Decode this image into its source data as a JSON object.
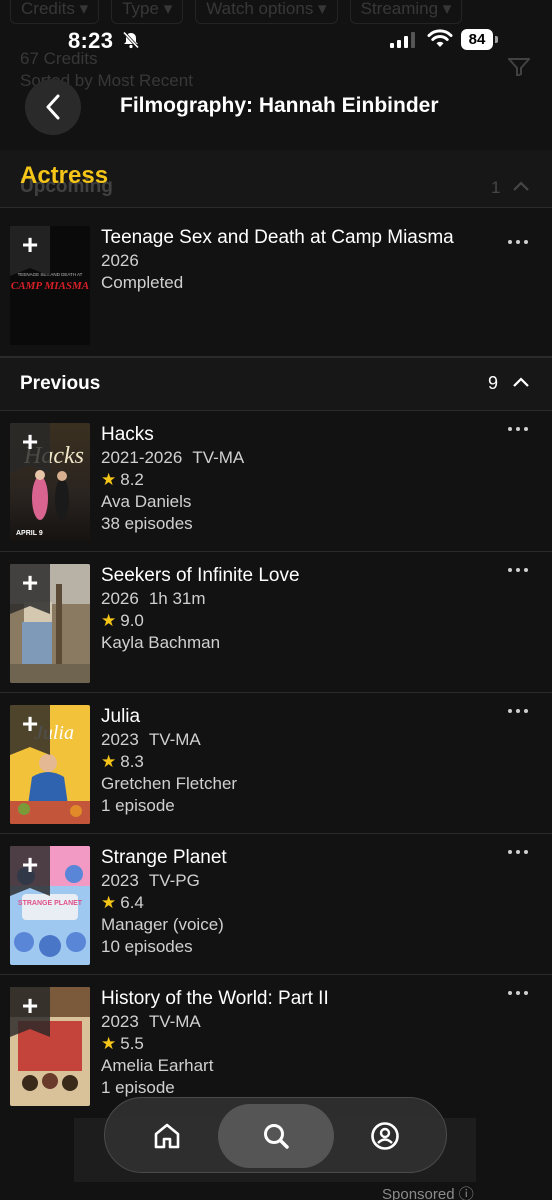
{
  "background_ghost": {
    "filter_chips": [
      "Credits ▾",
      "Type ▾",
      "Watch options ▾",
      "Streaming ▾"
    ],
    "credits_count": "67 Credits",
    "sorted_by": "Sorted by Most Recent"
  },
  "status_bar": {
    "time": "8:23",
    "battery": "84"
  },
  "header": {
    "title": "Filmography: Hannah Einbinder"
  },
  "actress_section": {
    "label": "Actress",
    "upcoming_ghost": "Upcoming",
    "upcoming_count": "1"
  },
  "upcoming": [
    {
      "title": "Teenage Sex and Death at Camp Miasma",
      "year": "2026",
      "status": "Completed"
    }
  ],
  "previous_section": {
    "label": "Previous",
    "count": "9"
  },
  "previous": [
    {
      "title": "Hacks",
      "year": "2021-2026",
      "cert": "TV-MA",
      "rating": "8.2",
      "role": "Ava Daniels",
      "episodes": "38 episodes"
    },
    {
      "title": "Seekers of Infinite Love",
      "year": "2026",
      "cert": "1h 31m",
      "rating": "9.0",
      "role": "Kayla Bachman",
      "episodes": ""
    },
    {
      "title": "Julia",
      "year": "2023",
      "cert": "TV-MA",
      "rating": "8.3",
      "role": "Gretchen Fletcher",
      "episodes": "1 episode"
    },
    {
      "title": "Strange Planet",
      "year": "2023",
      "cert": "TV-PG",
      "rating": "6.4",
      "role": "Manager (voice)",
      "episodes": "10 episodes"
    },
    {
      "title": "History of the World: Part II",
      "year": "2023",
      "cert": "TV-MA",
      "rating": "5.5",
      "role": "Amelia Earhart",
      "episodes": "1 episode"
    }
  ],
  "posters": {
    "camp_miasma": "CAMP MIASMA",
    "hacks": "Hacks",
    "hacks_date": "APRIL 9",
    "julia": "Julia",
    "strange_planet": "STRANGE PLANET"
  },
  "ad": {
    "sponsored": "Sponsored ⓘ"
  },
  "colors": {
    "accent": "#f5c518",
    "background": "#121212"
  },
  "nav": [
    "home-icon",
    "search-icon",
    "profile-icon"
  ]
}
